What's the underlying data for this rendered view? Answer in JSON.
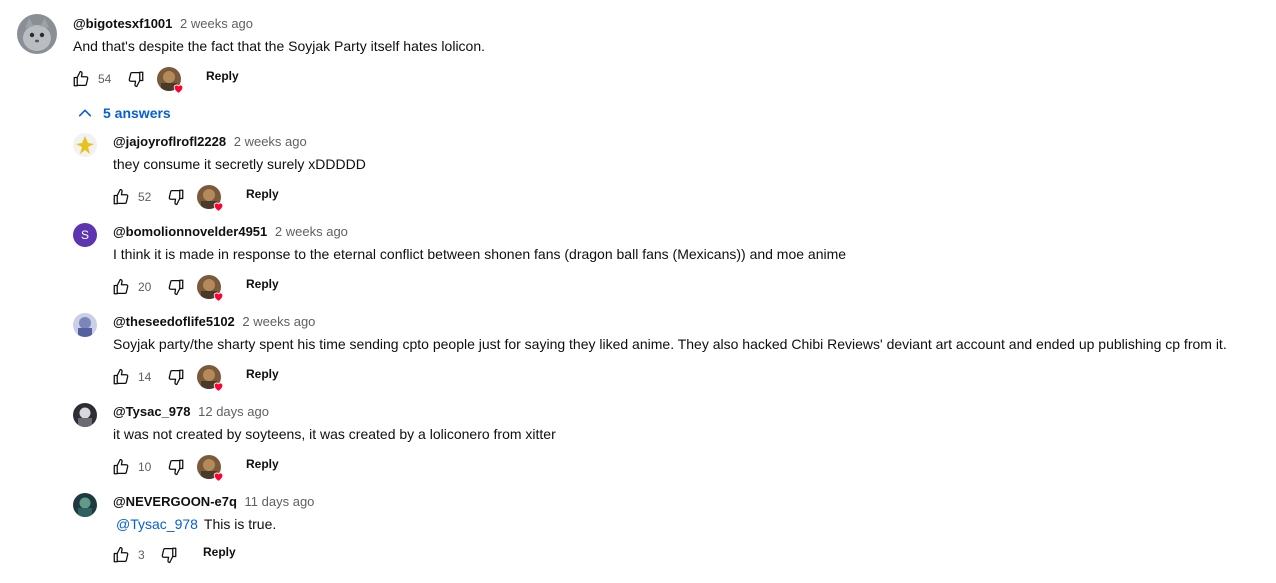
{
  "colors": {
    "link": "#065fd4",
    "secondary_text": "#606060",
    "heart": "#ff0033",
    "text": "#0f0f0f"
  },
  "top_comment": {
    "author": "@bigotesxf1001",
    "time": "2 weeks ago",
    "text": "And that's despite the fact that the Soyjak Party itself hates lolicon.",
    "likes": "54",
    "reply_label": "Reply",
    "avatar_icon": "cat-avatar"
  },
  "replies_toggle": {
    "label": "5 answers",
    "icon": "chevron-up-icon"
  },
  "replies": [
    {
      "author": "@jajoyroflrofl2228",
      "time": "2 weeks ago",
      "text": "they consume it secretly surely xDDDDD",
      "likes": "52",
      "reply_label": "Reply",
      "hearted": true,
      "avatar": "yellow-figure-avatar"
    },
    {
      "author": "@bomolionnovelder4951",
      "time": "2 weeks ago",
      "text": "I think it is made in response to the eternal conflict between shonen fans (dragon ball fans (Mexicans)) and moe anime",
      "likes": "20",
      "reply_label": "Reply",
      "hearted": true,
      "avatar_letter": "S",
      "avatar_color": "#5e35b1"
    },
    {
      "author": "@theseedoflife5102",
      "time": "2 weeks ago",
      "text": "Soyjak party/the sharty spent his time sending cpto people just for saying they liked anime. They also hacked Chibi Reviews' deviant art account and ended up publishing cp from it.",
      "likes": "14",
      "reply_label": "Reply",
      "hearted": true,
      "avatar": "anime-avatar"
    },
    {
      "author": "@Tysac_978",
      "time": "12 days ago",
      "text": "it was not created by soyteens, it was created by a loliconero from xitter",
      "likes": "10",
      "reply_label": "Reply",
      "hearted": true,
      "avatar": "dark-avatar"
    },
    {
      "author": "@NEVERGOON-e7q",
      "time": "11 days ago",
      "mention": "@Tysac_978",
      "text": "This is true.",
      "likes": "3",
      "reply_label": "Reply",
      "hearted": false,
      "avatar": "teal-avatar"
    }
  ]
}
